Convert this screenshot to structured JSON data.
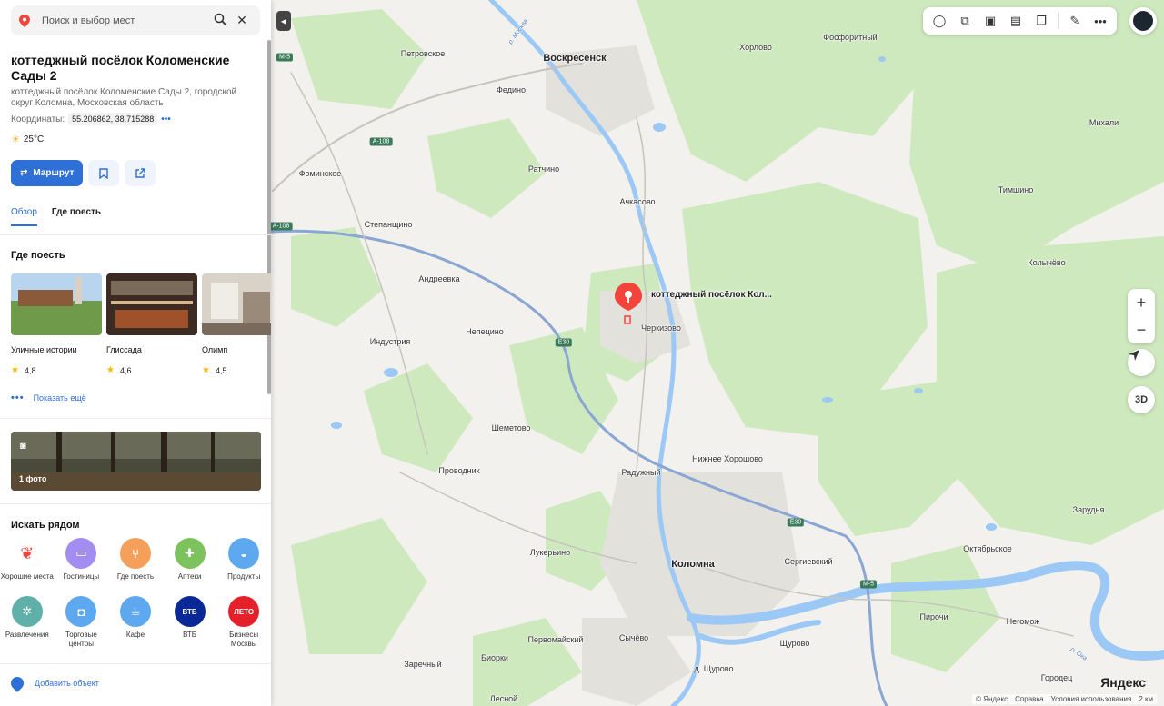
{
  "search": {
    "placeholder": "Поиск и выбор мест"
  },
  "place": {
    "title": "коттеджный посёлок Коломенские Сады 2",
    "address": "коттеджный посёлок Коломенские Сады 2, городской округ Коломна, Московская область",
    "coords_label": "Координаты:",
    "coords_value": "55.206862, 38.715288",
    "weather": "25°C"
  },
  "actions": {
    "route": "Маршрут"
  },
  "tabs": [
    {
      "label": "Обзор",
      "active": true
    },
    {
      "label": "Где поесть",
      "active": false
    }
  ],
  "where_to_eat": {
    "title": "Где поесть",
    "items": [
      {
        "name": "Уличные истории",
        "rating": "4,8"
      },
      {
        "name": "Глиссада",
        "rating": "4,6"
      },
      {
        "name": "Олимп",
        "rating": "4,5"
      }
    ],
    "show_more": "Показать ещё"
  },
  "photos": {
    "count_label": "1 фото"
  },
  "nearby": {
    "title": "Искать рядом",
    "items": [
      {
        "label": "Хорошие места",
        "icon": "laurel-pin-icon",
        "color": "#ffffff"
      },
      {
        "label": "Гостиницы",
        "icon": "bed-icon",
        "color": "#a48df0"
      },
      {
        "label": "Где поесть",
        "icon": "fork-knife-icon",
        "color": "#f5a05a"
      },
      {
        "label": "Аптеки",
        "icon": "cross-icon",
        "color": "#7cc35d"
      },
      {
        "label": "Продукты",
        "icon": "basket-icon",
        "color": "#5ea8f0"
      },
      {
        "label": "Развлечения",
        "icon": "wheel-icon",
        "color": "#5fb0a8"
      },
      {
        "label": "Торговые центры",
        "icon": "bag-icon",
        "color": "#5ea8f0"
      },
      {
        "label": "Кафе",
        "icon": "cup-icon",
        "color": "#5ea8f0"
      },
      {
        "label": "ВТБ",
        "icon": "vtb-logo",
        "color": "#0a2896",
        "badge": "ВТБ"
      },
      {
        "label": "Бизнесы Москвы",
        "icon": "leto-logo",
        "color": "#e4202a",
        "badge": "ЛЕТО"
      }
    ]
  },
  "add_object": "Добавить объект",
  "map": {
    "pin_label": "коттеджный посёлок Кол...",
    "places": [
      {
        "name": "Воскресенск",
        "big": true
      },
      {
        "name": "Петровское"
      },
      {
        "name": "Федино"
      },
      {
        "name": "Хорлово"
      },
      {
        "name": "Фосфоритный"
      },
      {
        "name": "Михали"
      },
      {
        "name": "Фоминское"
      },
      {
        "name": "Ратчино"
      },
      {
        "name": "Ачкасово"
      },
      {
        "name": "Тимшино"
      },
      {
        "name": "Степанщино"
      },
      {
        "name": "Андреевка"
      },
      {
        "name": "Колычёво"
      },
      {
        "name": "Непецино"
      },
      {
        "name": "Черкизово"
      },
      {
        "name": "Индустрия"
      },
      {
        "name": "Шеметово"
      },
      {
        "name": "Нижнее Хорошово"
      },
      {
        "name": "Проводник"
      },
      {
        "name": "Радужный"
      },
      {
        "name": "Зарудня"
      },
      {
        "name": "Лукерьино"
      },
      {
        "name": "Коломна",
        "big": true
      },
      {
        "name": "Сергиевский"
      },
      {
        "name": "Октябрьское"
      },
      {
        "name": "Первомайский"
      },
      {
        "name": "Сычёво"
      },
      {
        "name": "Пирочи"
      },
      {
        "name": "Негомож"
      },
      {
        "name": "Биорки"
      },
      {
        "name": "Щурово"
      },
      {
        "name": "Заречный"
      },
      {
        "name": "д. Щурово"
      },
      {
        "name": "Городец"
      },
      {
        "name": "Лесной"
      }
    ],
    "rivers": [
      "р. Москва",
      "р. Ока"
    ],
    "road_badges": [
      "М-5",
      "А-108",
      "А-108",
      "Е30",
      "Е30",
      "М-5"
    ],
    "zoom_in": "+",
    "zoom_out": "−",
    "btn_3d": "3D",
    "logo": "Яндекс",
    "footer": [
      "© Яндекс",
      "Справка",
      "Условия использования"
    ],
    "scale": "2 км"
  },
  "colors": {
    "accent": "#2f6fd8",
    "forest": "#cfe9bf",
    "water": "#9cc8f5",
    "pin": "#f2443a"
  }
}
